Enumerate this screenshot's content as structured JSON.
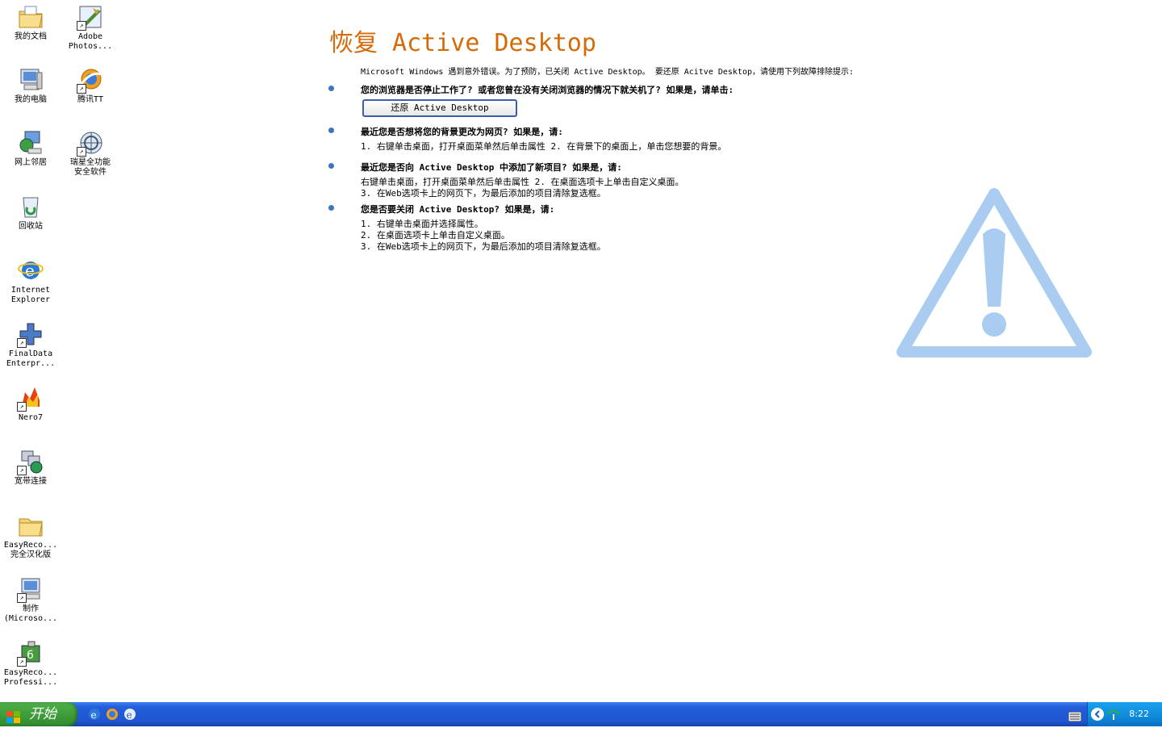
{
  "desktop": {
    "icons": [
      {
        "id": "my-documents",
        "label": "我的文档",
        "label2": "",
        "icon": "folder-docs-icon",
        "shortcut": false
      },
      {
        "id": "photoshop",
        "label": "Adobe",
        "label2": "Photos...",
        "icon": "photoshop-icon",
        "shortcut": true
      },
      {
        "id": "my-computer",
        "label": "我的电脑",
        "label2": "",
        "icon": "computer-icon",
        "shortcut": false
      },
      {
        "id": "tencent-tt",
        "label": "腾讯TT",
        "label2": "",
        "icon": "browser-tt-icon",
        "shortcut": true
      },
      {
        "id": "network",
        "label": "网上邻居",
        "label2": "",
        "icon": "network-icon",
        "shortcut": false
      },
      {
        "id": "rising",
        "label": "瑞星全功能",
        "label2": "安全软件",
        "icon": "rising-antivirus-icon",
        "shortcut": true
      },
      {
        "id": "recycle-bin",
        "label": "回收站",
        "label2": "",
        "icon": "recycle-bin-icon",
        "shortcut": false
      },
      {
        "id": "ie",
        "label": "Internet",
        "label2": "Explorer",
        "icon": "internet-explorer-icon",
        "shortcut": false
      },
      {
        "id": "finaldata",
        "label": "FinalData",
        "label2": "Enterpr...",
        "icon": "finaldata-icon",
        "shortcut": true
      },
      {
        "id": "nero",
        "label": "Nero7",
        "label2": "",
        "icon": "nero-icon",
        "shortcut": true
      },
      {
        "id": "broadband",
        "label": "宽带连接",
        "label2": "",
        "icon": "broadband-icon",
        "shortcut": true
      },
      {
        "id": "easyrecovery-cn",
        "label": "EasyReco...",
        "label2": "完全汉化版",
        "icon": "folder-icon",
        "shortcut": false
      },
      {
        "id": "make-ms",
        "label": "制作",
        "label2": "(Microso...",
        "icon": "computer-shortcut-icon",
        "shortcut": true
      },
      {
        "id": "easyrecovery-pro",
        "label": "EasyReco...",
        "label2": "Professi...",
        "icon": "easyrecovery-icon",
        "shortcut": true
      }
    ]
  },
  "recovery": {
    "title": "恢复 Active Desktop",
    "intro": "Microsoft Windows 遇到意外错误。为了预防，已关闭 Active Desktop。 要还原 Acitve Desktop，请使用下列故障排除提示:",
    "q1": "您的浏览器是否停止工作了? 或者您曾在没有关闭浏览器的情况下就关机了? 如果是，请单击:",
    "restore_button": "还原 Active Desktop",
    "q2": "最近您是否想将您的背景更改为网页? 如果是，请:",
    "q2_steps": [
      "1. 右键单击桌面，打开桌面菜单然后单击属性 2. 在背景下的桌面上，单击您想要的背景。"
    ],
    "q3": "最近您是否向 Active Desktop 中添加了新项目? 如果是，请:",
    "q3_steps": [
      "右键单击桌面，打开桌面菜单然后单击属性 2. 在桌面选项卡上单击自定义桌面。",
      "3. 在Web选项卡上的网页下，为最后添加的项目清除复选框。"
    ],
    "q4": "您是否要关闭 Active Desktop? 如果是，请:",
    "q4_steps": [
      "1. 右键单击桌面并选择属性。",
      "2. 在桌面选项卡上单击自定义桌面。",
      "3. 在Web选项卡上的网页下，为最后添加的项目清除复选框。"
    ]
  },
  "taskbar": {
    "start_label": "开始",
    "quick_launch": [
      "internet-explorer-icon",
      "browser-tt-icon",
      "ie-alt-icon"
    ],
    "clock": "8:22",
    "accent": "#245edb",
    "start_color": "#3c9a38"
  },
  "colors": {
    "title": "#d46b08",
    "bullet": "#3b74c0",
    "warning": "#a9ccf0"
  }
}
